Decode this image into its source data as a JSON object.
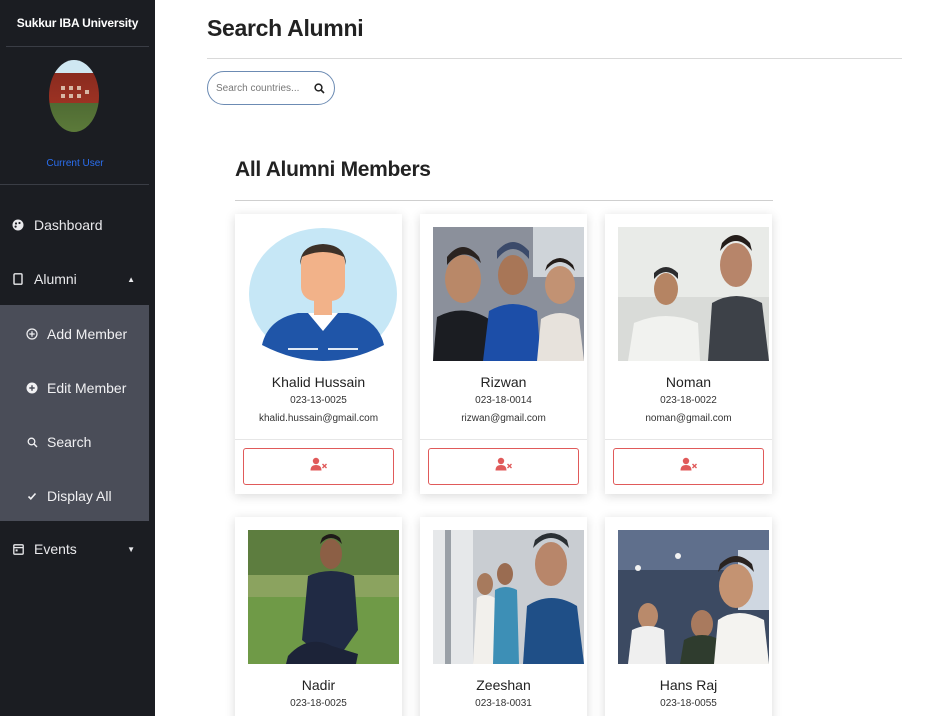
{
  "sidebar": {
    "brand": "Sukkur IBA University",
    "user_label": "Current User",
    "items": [
      {
        "label": "Dashboard",
        "icon": "palette-icon"
      },
      {
        "label": "Alumni",
        "icon": "book-icon"
      },
      {
        "label": "Events",
        "icon": "calendar-icon"
      }
    ],
    "alumni_submenu": [
      {
        "label": "Add Member",
        "icon": "plus-circle-outline-icon"
      },
      {
        "label": "Edit Member",
        "icon": "plus-circle-filled-icon"
      },
      {
        "label": "Search",
        "icon": "search-icon"
      },
      {
        "label": "Display All",
        "icon": "check-icon"
      }
    ]
  },
  "header": {
    "title": "Search Alumni"
  },
  "search": {
    "placeholder": "Search countries..."
  },
  "section": {
    "title": "All Alumni Members"
  },
  "members": [
    {
      "name": "Khalid Hussain",
      "roll": "023-13-0025",
      "email": "khalid.hussain@gmail.com"
    },
    {
      "name": "Rizwan",
      "roll": "023-18-0014",
      "email": "rizwan@gmail.com"
    },
    {
      "name": "Noman",
      "roll": "023-18-0022",
      "email": "noman@gmail.com"
    },
    {
      "name": "Nadir",
      "roll": "023-18-0025",
      "email": ""
    },
    {
      "name": "Zeeshan",
      "roll": "023-18-0031",
      "email": ""
    },
    {
      "name": "Hans Raj",
      "roll": "023-18-0055",
      "email": ""
    }
  ],
  "colors": {
    "sidebar_bg": "#1b1d22",
    "submenu_bg": "#4a4d58",
    "accent_blue": "#2b6ff0",
    "danger_red": "#e05a5a"
  }
}
